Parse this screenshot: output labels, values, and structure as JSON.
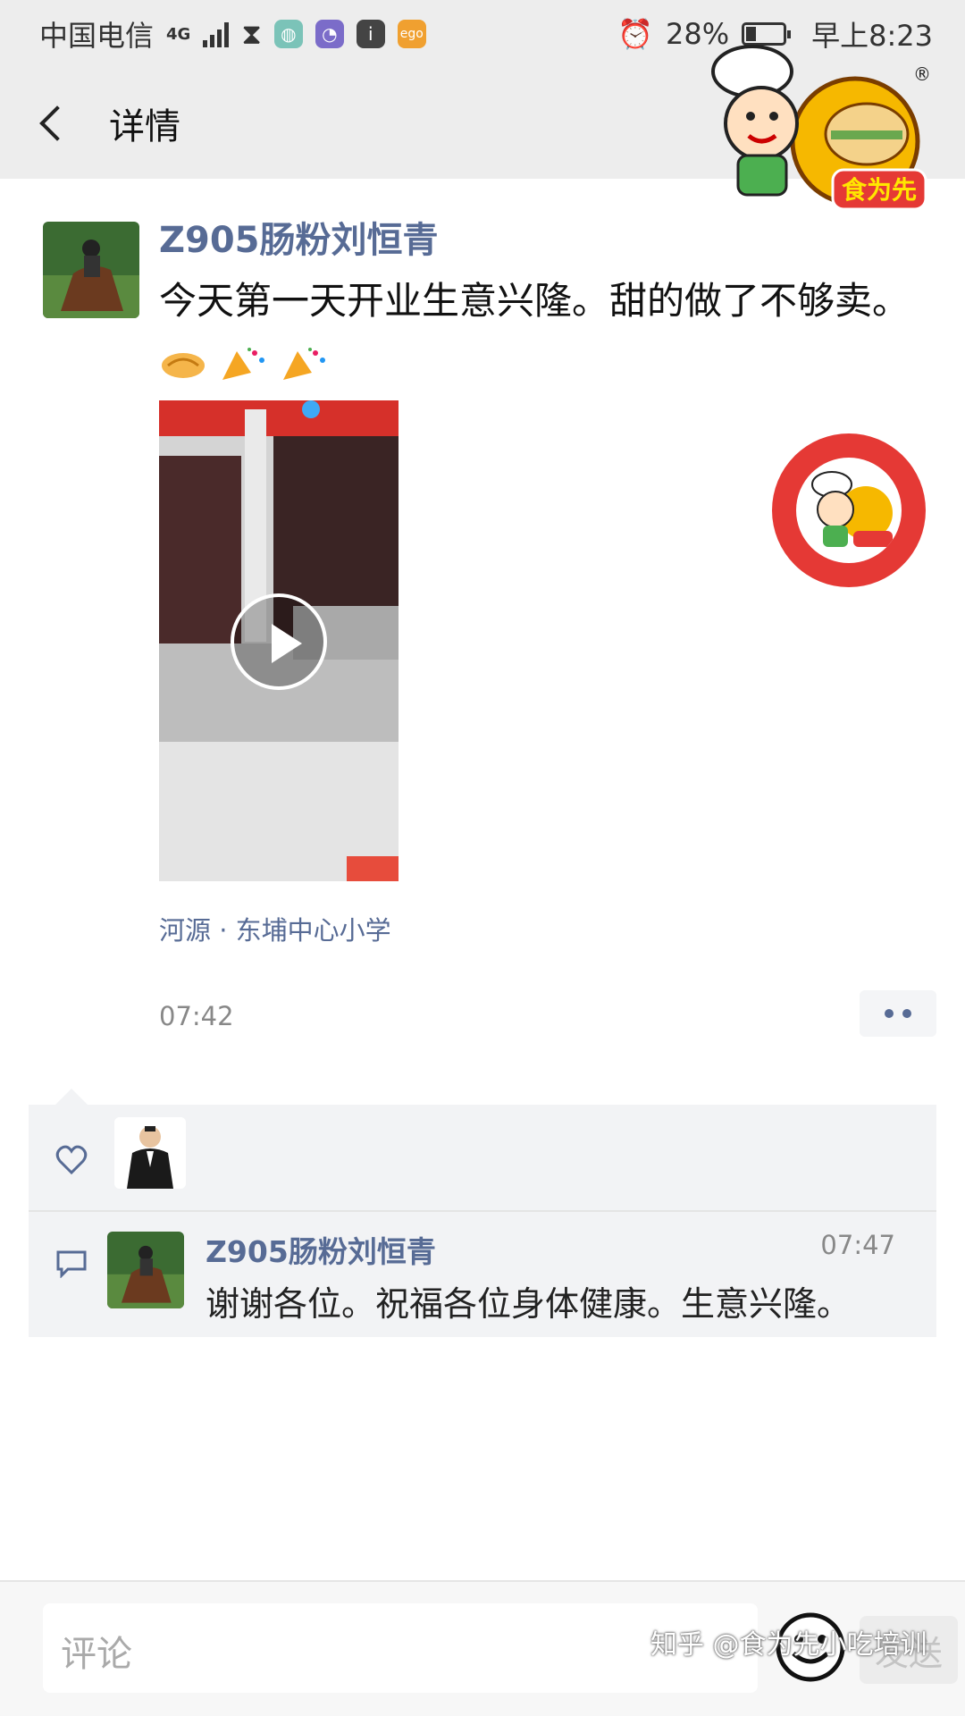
{
  "status_bar": {
    "carrier": "中国电信",
    "network": "4G",
    "battery": "28%",
    "battery_level": 0.28,
    "time": "早上8:23"
  },
  "nav": {
    "title": "详情"
  },
  "watermark": {
    "brand": "食为先",
    "credit": "知乎 @食为先小吃培训"
  },
  "post": {
    "author": "Z905肠粉刘恒青",
    "text": "今天第一天开业生意兴隆。甜的做了不够卖。",
    "location": "河源 · 东埔中心小学",
    "time": "07:42"
  },
  "comment": {
    "author": "Z905肠粉刘恒青",
    "time": "07:47",
    "text": "谢谢各位。祝福各位身体健康。生意兴隆。"
  },
  "bottom_bar": {
    "placeholder": "评论",
    "send_label": "发送"
  },
  "colors": {
    "link_blue": "#576b95",
    "brand_red": "#e53935",
    "panel_gray": "#f2f3f5"
  }
}
